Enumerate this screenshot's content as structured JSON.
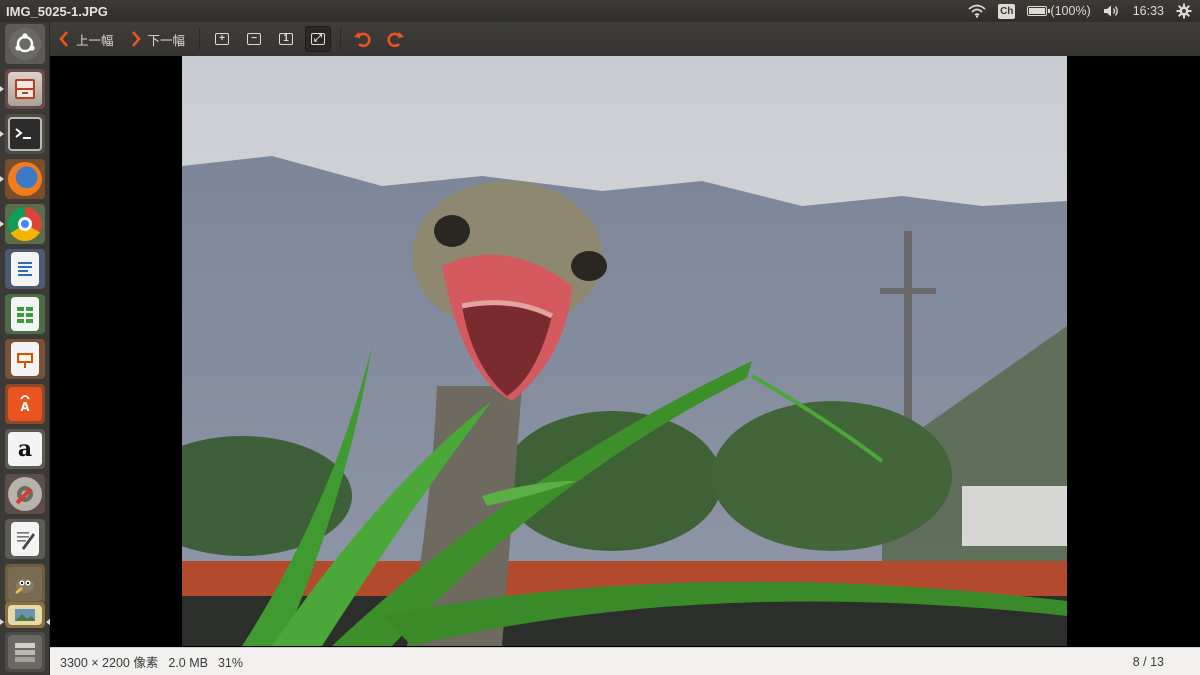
{
  "window": {
    "title": "IMG_5025-1.JPG"
  },
  "indicators": {
    "keyboard": "Ch",
    "battery": "(100%)",
    "battery_level": 1.0,
    "time": "16:33"
  },
  "launcher": {
    "items": [
      {
        "name": "dash-home",
        "icon": "ubuntu-logo-icon"
      },
      {
        "name": "files",
        "icon": "file-cabinet-icon"
      },
      {
        "name": "terminal",
        "icon": "terminal-icon"
      },
      {
        "name": "firefox",
        "icon": "firefox-icon"
      },
      {
        "name": "chrome",
        "icon": "chrome-icon"
      },
      {
        "name": "writer",
        "icon": "writer-doc-icon"
      },
      {
        "name": "calc",
        "icon": "spreadsheet-icon"
      },
      {
        "name": "impress",
        "icon": "presentation-icon"
      },
      {
        "name": "software-center",
        "icon": "shopping-bag-icon"
      },
      {
        "name": "amazon",
        "icon": "amazon-icon",
        "glyph": "a"
      },
      {
        "name": "system-settings",
        "icon": "settings-wrench-icon"
      },
      {
        "name": "text-editor",
        "icon": "text-editor-icon"
      },
      {
        "name": "gimp",
        "icon": "gimp-icon"
      },
      {
        "name": "image-viewer",
        "icon": "image-viewer-icon"
      },
      {
        "name": "workspaces",
        "icon": "workspace-switcher-icon"
      }
    ]
  },
  "toolbar": {
    "prev_label": "上一幅",
    "next_label": "下一幅",
    "zoom_in_glyph": "+",
    "zoom_out_glyph": "−",
    "actual_size_glyph": "1",
    "best_fit_glyph": "⤢"
  },
  "status": {
    "dimensions": "3300 × 2200 像素",
    "size": "2.0 MB",
    "zoom": "31%",
    "position": "8 / 13"
  },
  "colors": {
    "panel": "#3c3b37",
    "accent_orange": "#e95420",
    "launcher_bg": "#3b3a36"
  }
}
